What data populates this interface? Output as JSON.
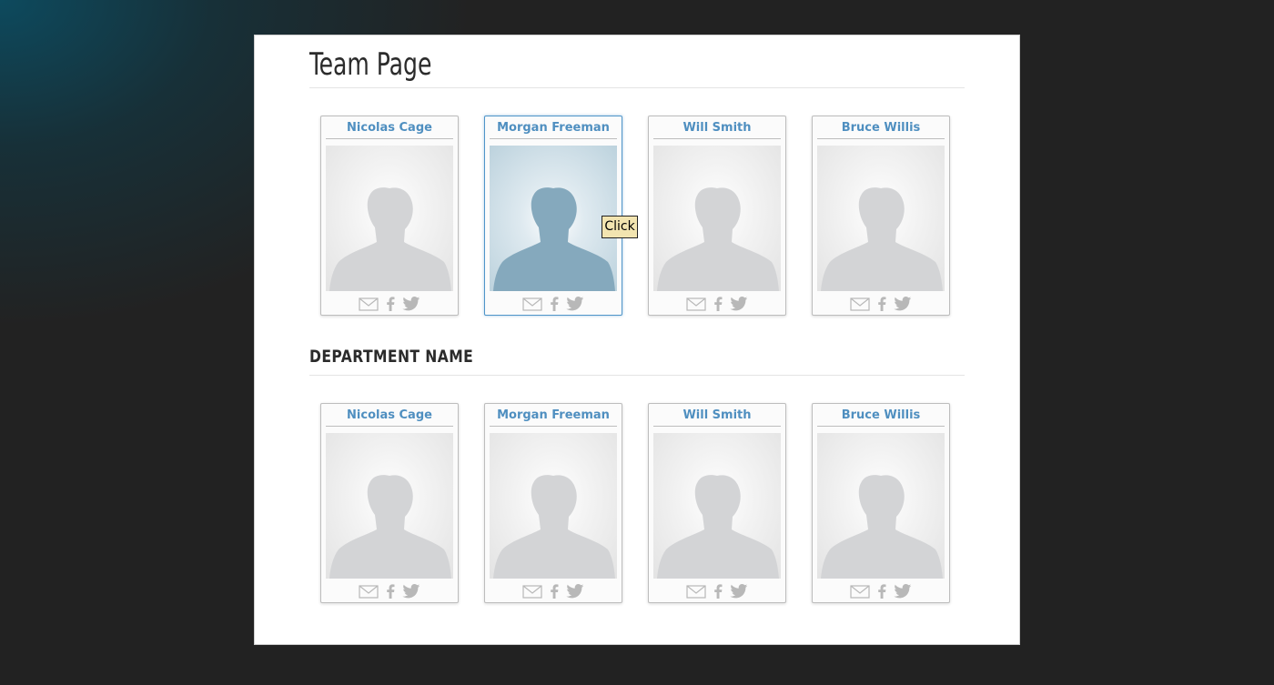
{
  "page": {
    "title": "Team Page"
  },
  "sections": [
    {
      "title": "",
      "members": [
        {
          "name": "Nicolas Cage"
        },
        {
          "name": "Morgan Freeman"
        },
        {
          "name": "Will Smith"
        },
        {
          "name": "Bruce Willis"
        }
      ]
    },
    {
      "title": "DEPARTMENT NAME",
      "members": [
        {
          "name": "Nicolas Cage"
        },
        {
          "name": "Morgan Freeman"
        },
        {
          "name": "Will Smith"
        },
        {
          "name": "Bruce Willis"
        }
      ]
    }
  ],
  "tooltip": {
    "text": "Click"
  },
  "icons": {
    "email": "email-icon",
    "facebook": "facebook-icon",
    "twitter": "twitter-icon"
  },
  "colors": {
    "accent": "#4f8fc0",
    "active_border": "#4f95c9",
    "tooltip_bg": "#f2e4b0"
  }
}
